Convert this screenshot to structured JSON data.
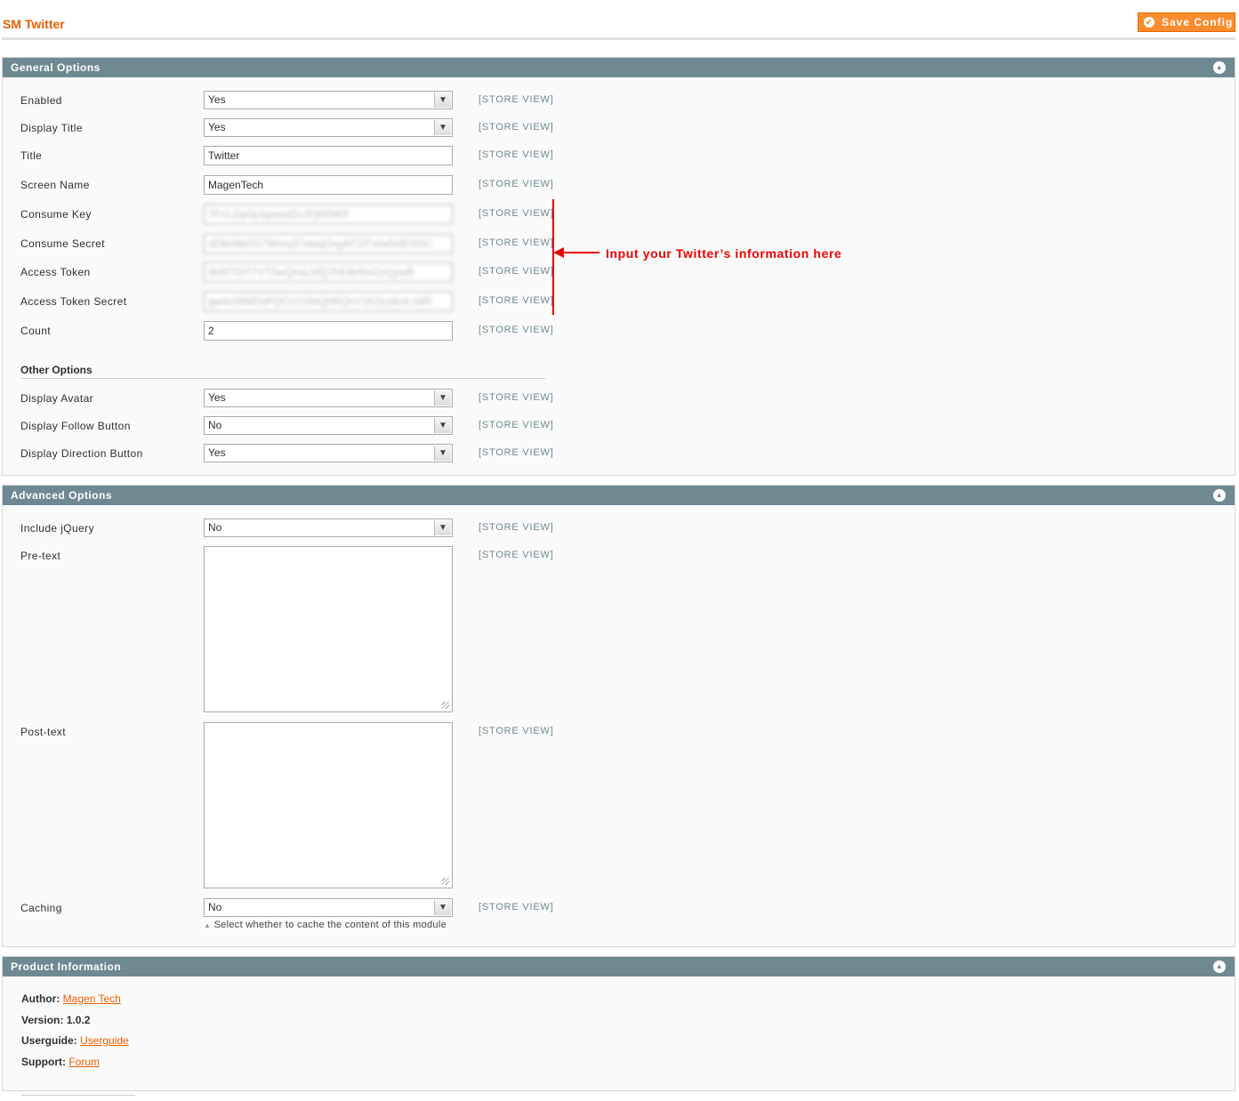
{
  "header": {
    "title": "SM Twitter",
    "save_label": "Save Config"
  },
  "general": {
    "title": "General Options",
    "fields": [
      {
        "label": "Enabled",
        "type": "select",
        "value": "Yes"
      },
      {
        "label": "Display Title",
        "type": "select",
        "value": "Yes"
      },
      {
        "label": "Title",
        "type": "text",
        "value": "Twitter"
      },
      {
        "label": "Screen Name",
        "type": "text",
        "value": "MagenTech"
      },
      {
        "label": "Consume Key",
        "type": "secret",
        "value": "7FrrLDp0pSpeedZnJFj8RM0f"
      },
      {
        "label": "Consume Secret",
        "type": "secret",
        "value": "dD8n8bDG7Wsrq37weqGxgAT1fTxhe5r8DS0C"
      },
      {
        "label": "Access Token",
        "type": "secret",
        "value": "8b5f7DlT7VT0wQhaLhfQ7hE8eNsOzQywB"
      },
      {
        "label": "Access Token Secret",
        "type": "secret",
        "value": "gw4nt9WEhPQCU1SMQhRQnV1K2sx8rsLn8R"
      },
      {
        "label": "Count",
        "type": "text",
        "value": "2"
      }
    ],
    "other_heading": "Other Options",
    "other_fields": [
      {
        "label": "Display Avatar",
        "value": "Yes"
      },
      {
        "label": "Display Follow Button",
        "value": "No"
      },
      {
        "label": "Display Direction Button",
        "value": "Yes"
      }
    ],
    "scope": "[STORE VIEW]"
  },
  "annotation": {
    "text": "Input your Twitter’s information here"
  },
  "advanced": {
    "title": "Advanced Options",
    "include_jquery": {
      "label": "Include jQuery",
      "value": "No"
    },
    "pre_text": {
      "label": "Pre-text"
    },
    "post_text": {
      "label": "Post-text"
    },
    "caching": {
      "label": "Caching",
      "value": "No",
      "hint": "Select whether to cache the content of this module"
    },
    "scope": "[STORE VIEW]"
  },
  "product": {
    "title": "Product Information",
    "author_label": "Author:",
    "author_value": "Magen Tech",
    "version_label": "Version:",
    "version_value": "1.0.2",
    "userguide_label": "Userguide:",
    "userguide_value": "Userguide",
    "support_label": "Support:",
    "support_value": "Forum"
  },
  "icons": {
    "save": "check-icon",
    "collapse": "chevron-up-icon",
    "dropdown": "chevron-down-icon"
  }
}
